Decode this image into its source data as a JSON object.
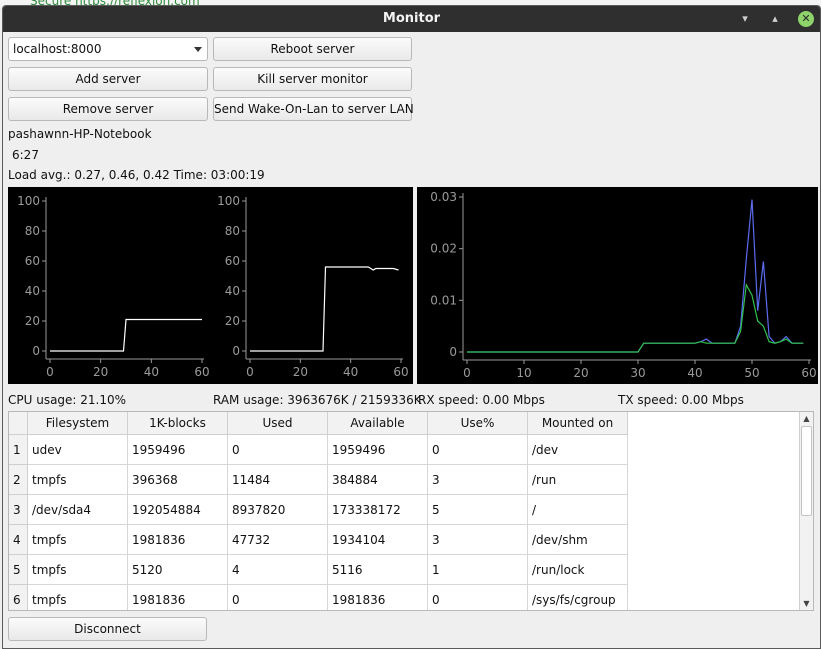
{
  "background": {
    "address_fragment": "Secure  https://reflexion.com"
  },
  "window": {
    "title": "Monitor",
    "minimize_glyph": "▾",
    "maximize_glyph": "▴",
    "close_glyph": "✕"
  },
  "controls": {
    "server_select": {
      "value": "localhost:8000"
    },
    "reboot_label": "Reboot server",
    "add_label": "Add server",
    "kill_label": "Kill server monitor",
    "remove_label": "Remove server",
    "wol_label": "Send Wake-On-Lan to server LAN",
    "disconnect_label": "Disconnect"
  },
  "server_info": {
    "hostname": "pashawnn-HP-Notebook",
    "uptime": "6:27",
    "load": "Load avg.: 0.27, 0.46, 0.42 Time: 03:00:19"
  },
  "stats": {
    "cpu": "CPU usage: 21.10%",
    "ram": "RAM usage: 3963676K / 2159336K",
    "rx": "RX speed: 0.00 Mbps",
    "tx": "TX speed: 0.00 Mbps"
  },
  "chart_data": [
    {
      "type": "line",
      "xlim": [
        0,
        60
      ],
      "ylim": [
        0,
        100
      ],
      "xticks": [
        "0",
        "20",
        "40",
        "60"
      ],
      "yticks": [
        "0",
        "20",
        "40",
        "60",
        "80",
        "100"
      ],
      "series": [
        {
          "color": "#ffffff",
          "x": [
            0,
            29,
            30,
            60
          ],
          "y": [
            0,
            0,
            21,
            21
          ]
        }
      ]
    },
    {
      "type": "line",
      "xlim": [
        0,
        60
      ],
      "ylim": [
        0,
        100
      ],
      "xticks": [
        "0",
        "20",
        "40",
        "60"
      ],
      "yticks": [
        "0",
        "20",
        "40",
        "60",
        "80",
        "100"
      ],
      "series": [
        {
          "color": "#ffffff",
          "x": [
            0,
            29,
            30,
            47,
            48,
            49,
            50,
            57,
            59
          ],
          "y": [
            0,
            0,
            56,
            56,
            55,
            54,
            55,
            55,
            54
          ]
        }
      ]
    },
    {
      "type": "line",
      "xlim": [
        0,
        60
      ],
      "ylim": [
        0,
        0.03
      ],
      "xticks": [
        "0",
        "10",
        "20",
        "30",
        "40",
        "50",
        "60"
      ],
      "yticks": [
        "0",
        "0.01",
        "0.02",
        "0.03"
      ],
      "series": [
        {
          "color": "#5b6cf0",
          "x": [
            0,
            30,
            31,
            40,
            41,
            42,
            43,
            47,
            48,
            49,
            50,
            51,
            52,
            53,
            54,
            55,
            56,
            57,
            58,
            59
          ],
          "y": [
            0,
            0,
            0.0017,
            0.0017,
            0.002,
            0.0025,
            0.0017,
            0.0017,
            0.005,
            0.018,
            0.0295,
            0.008,
            0.0175,
            0.003,
            0.0017,
            0.002,
            0.003,
            0.0017,
            0.0017,
            0.0017
          ]
        },
        {
          "color": "#2fc14a",
          "x": [
            0,
            30,
            31,
            40,
            41,
            42,
            43,
            47,
            48,
            49,
            50,
            51,
            52,
            53,
            54,
            55,
            56,
            57,
            58,
            59
          ],
          "y": [
            0,
            0,
            0.0017,
            0.0017,
            0.002,
            0.0017,
            0.0017,
            0.0017,
            0.004,
            0.013,
            0.011,
            0.006,
            0.005,
            0.002,
            0.0017,
            0.002,
            0.0025,
            0.0017,
            0.0017,
            0.0017
          ]
        }
      ]
    }
  ],
  "filesystem_table": {
    "columns": [
      "Filesystem",
      "1K-blocks",
      "Used",
      "Available",
      "Use%",
      "Mounted on"
    ],
    "row_numbers": [
      "1",
      "2",
      "3",
      "4",
      "5",
      "6"
    ],
    "rows": [
      [
        "udev",
        "1959496",
        "0",
        "1959496",
        "0",
        "/dev"
      ],
      [
        "tmpfs",
        "396368",
        "11484",
        "384884",
        "3",
        "/run"
      ],
      [
        "/dev/sda4",
        "192054884",
        "8937820",
        "173338172",
        "5",
        "/"
      ],
      [
        "tmpfs",
        "1981836",
        "47732",
        "1934104",
        "3",
        "/dev/shm"
      ],
      [
        "tmpfs",
        "5120",
        "4",
        "5116",
        "1",
        "/run/lock"
      ],
      [
        "tmpfs",
        "1981836",
        "0",
        "1981836",
        "0",
        "/sys/fs/cgroup"
      ]
    ],
    "scroll_up_glyph": "▲",
    "scroll_down_glyph": "▼"
  }
}
